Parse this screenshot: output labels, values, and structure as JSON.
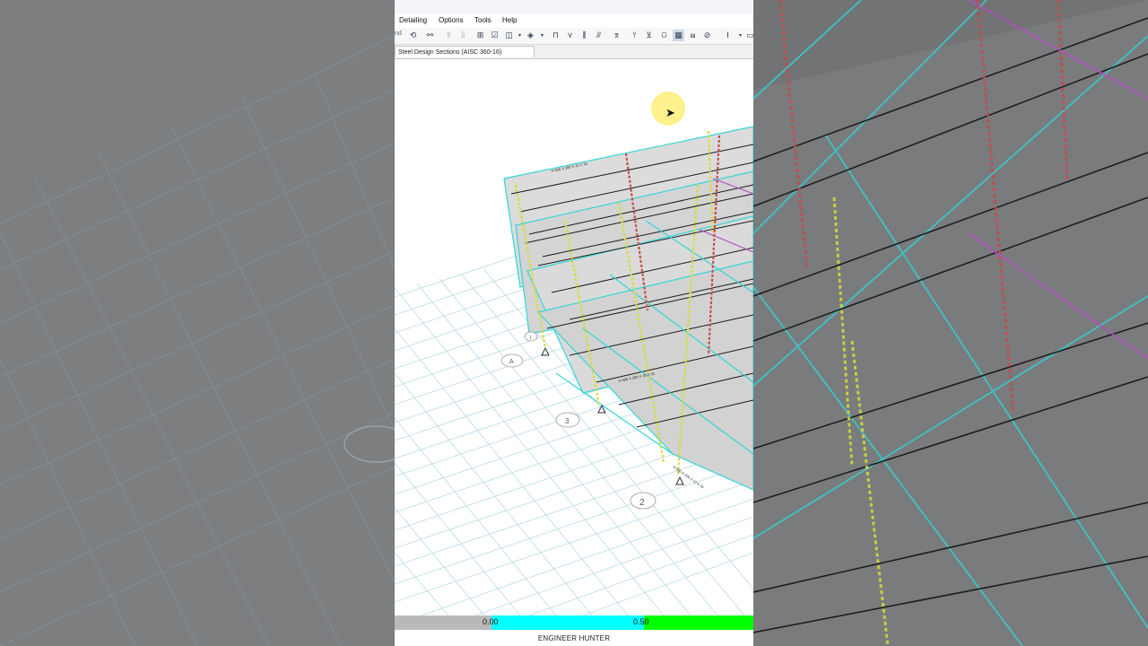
{
  "menu": {
    "items": [
      {
        "label": "Detailing"
      },
      {
        "label": "Options"
      },
      {
        "label": "Tools"
      },
      {
        "label": "Help"
      }
    ]
  },
  "toolbar": {
    "truncated_label": "nd",
    "icons": [
      "refresh-icon",
      "rubber-band-zoom-icon",
      "move-up-icon",
      "move-down-icon",
      "select-object-icon",
      "checkbox-icon",
      "section-cut-icon",
      "3d-box-icon",
      "frame-icon",
      "brace-icon",
      "grid-lines-icon",
      "deck-icon",
      "link-icon",
      "joint-icon",
      "support-icon",
      "area-icon",
      "wall-icon",
      "slab-icon",
      "spring-icon",
      "cross-icon",
      "text-cursor-icon",
      "dropdown-icon",
      "window-icon"
    ]
  },
  "tab": {
    "title": "Steel Design Sections  (AISC 360-16)"
  },
  "model": {
    "grid_bubbles": [
      "A",
      "3",
      "2",
      "1"
    ],
    "section_label": "H 500 X 200 X 10 X 16"
  },
  "legend": {
    "colors": {
      "low": "#00ffff",
      "mid": "#00ff00",
      "base": "#b9b9b9"
    },
    "values": [
      "0.00",
      "0.50"
    ]
  },
  "watermark": {
    "text": "ENGINEER HUNTER"
  },
  "colors": {
    "frame_cyan": "#33d6d6",
    "column_yellow": "#d8dc36",
    "beam_red": "#c94a4a",
    "slab": "#d9d9d9"
  }
}
